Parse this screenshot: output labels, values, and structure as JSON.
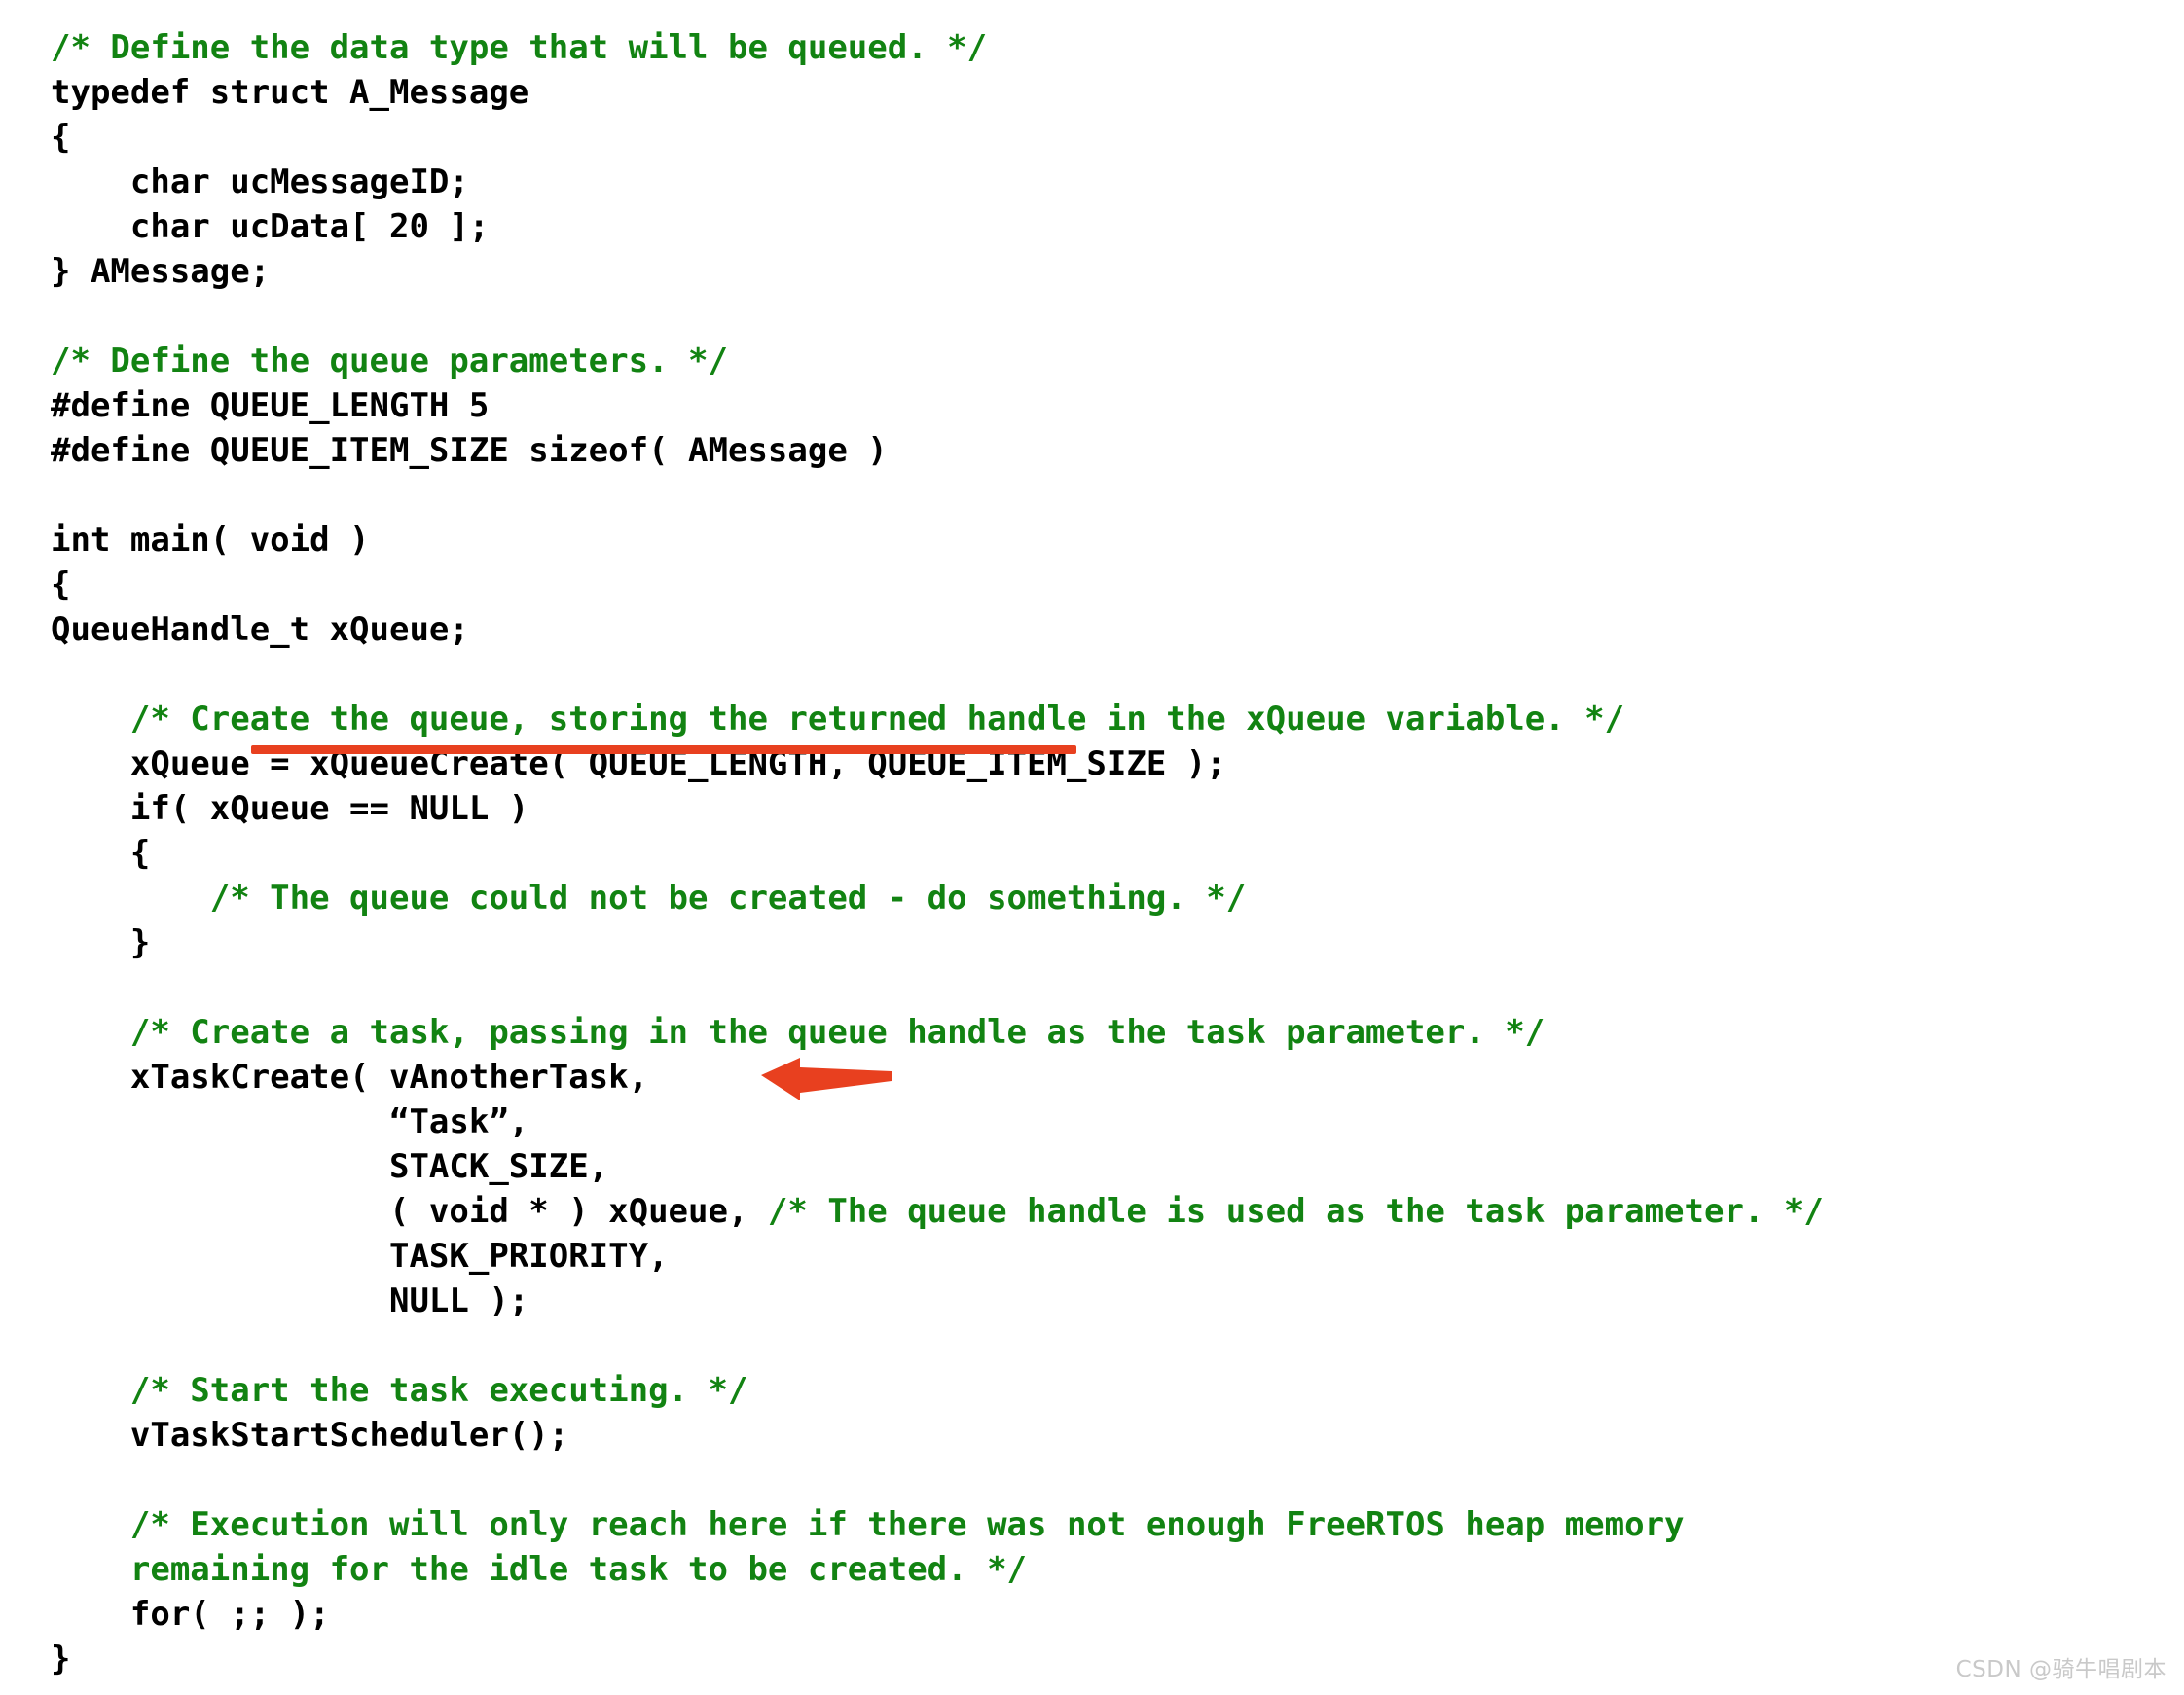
{
  "document": {
    "kind": "code-snippet-screenshot",
    "language": "C",
    "background_color": "#ffffff",
    "code_color": "#000000",
    "comment_color": "#128312",
    "annotation_color": "#e8401f",
    "lines": [
      {
        "indent": 0,
        "segments": [
          {
            "type": "comment",
            "text": "/* Define the data type that will be queued. */"
          }
        ]
      },
      {
        "indent": 0,
        "segments": [
          {
            "type": "code",
            "text": "typedef struct A_Message"
          }
        ]
      },
      {
        "indent": 0,
        "segments": [
          {
            "type": "code",
            "text": "{"
          }
        ]
      },
      {
        "indent": 0,
        "segments": [
          {
            "type": "code",
            "text": "    char ucMessageID;"
          }
        ]
      },
      {
        "indent": 0,
        "segments": [
          {
            "type": "code",
            "text": "    char ucData[ 20 ];"
          }
        ]
      },
      {
        "indent": 0,
        "segments": [
          {
            "type": "code",
            "text": "} AMessage;"
          }
        ]
      },
      {
        "indent": 0,
        "segments": [
          {
            "type": "code",
            "text": ""
          }
        ]
      },
      {
        "indent": 0,
        "segments": [
          {
            "type": "comment",
            "text": "/* Define the queue parameters. */"
          }
        ]
      },
      {
        "indent": 0,
        "segments": [
          {
            "type": "code",
            "text": "#define QUEUE_LENGTH 5"
          }
        ]
      },
      {
        "indent": 0,
        "segments": [
          {
            "type": "code",
            "text": "#define QUEUE_ITEM_SIZE sizeof( AMessage )"
          }
        ]
      },
      {
        "indent": 0,
        "segments": [
          {
            "type": "code",
            "text": ""
          }
        ]
      },
      {
        "indent": 0,
        "segments": [
          {
            "type": "code",
            "text": "int main( void )"
          }
        ]
      },
      {
        "indent": 0,
        "segments": [
          {
            "type": "code",
            "text": "{"
          }
        ]
      },
      {
        "indent": 0,
        "segments": [
          {
            "type": "code",
            "text": "QueueHandle_t xQueue;"
          }
        ]
      },
      {
        "indent": 0,
        "segments": [
          {
            "type": "code",
            "text": ""
          }
        ]
      },
      {
        "indent": 0,
        "segments": [
          {
            "type": "comment",
            "text": "    /* Create the queue, storing the returned handle in the xQueue variable. */"
          }
        ]
      },
      {
        "indent": 0,
        "segments": [
          {
            "type": "code",
            "text": "    xQueue = xQueueCreate( QUEUE_LENGTH, QUEUE_ITEM_SIZE );"
          }
        ]
      },
      {
        "indent": 0,
        "segments": [
          {
            "type": "code",
            "text": "    if( xQueue == NULL )"
          }
        ]
      },
      {
        "indent": 0,
        "segments": [
          {
            "type": "code",
            "text": "    {"
          }
        ]
      },
      {
        "indent": 0,
        "segments": [
          {
            "type": "comment",
            "text": "        /* The queue could not be created - do something. */"
          }
        ]
      },
      {
        "indent": 0,
        "segments": [
          {
            "type": "code",
            "text": "    }"
          }
        ]
      },
      {
        "indent": 0,
        "segments": [
          {
            "type": "code",
            "text": ""
          }
        ]
      },
      {
        "indent": 0,
        "segments": [
          {
            "type": "comment",
            "text": "    /* Create a task, passing in the queue handle as the task parameter. */"
          }
        ]
      },
      {
        "indent": 0,
        "segments": [
          {
            "type": "code",
            "text": "    xTaskCreate( vAnotherTask,"
          }
        ]
      },
      {
        "indent": 0,
        "segments": [
          {
            "type": "code",
            "text": "                 “Task”,"
          }
        ]
      },
      {
        "indent": 0,
        "segments": [
          {
            "type": "code",
            "text": "                 STACK_SIZE,"
          }
        ]
      },
      {
        "indent": 0,
        "segments": [
          {
            "type": "code",
            "text": "                 ( void * ) xQueue, "
          },
          {
            "type": "comment",
            "text": "/* The queue handle is used as the task parameter. */"
          }
        ]
      },
      {
        "indent": 0,
        "segments": [
          {
            "type": "code",
            "text": "                 TASK_PRIORITY,"
          }
        ]
      },
      {
        "indent": 0,
        "segments": [
          {
            "type": "code",
            "text": "                 NULL );"
          }
        ]
      },
      {
        "indent": 0,
        "segments": [
          {
            "type": "code",
            "text": ""
          }
        ]
      },
      {
        "indent": 0,
        "segments": [
          {
            "type": "comment",
            "text": "    /* Start the task executing. */"
          }
        ]
      },
      {
        "indent": 0,
        "segments": [
          {
            "type": "code",
            "text": "    vTaskStartScheduler();"
          }
        ]
      },
      {
        "indent": 0,
        "segments": [
          {
            "type": "code",
            "text": ""
          }
        ]
      },
      {
        "indent": 0,
        "segments": [
          {
            "type": "comment",
            "text": "    /* Execution will only reach here if there was not enough FreeRTOS heap memory"
          }
        ]
      },
      {
        "indent": 0,
        "segments": [
          {
            "type": "comment",
            "text": "    remaining for the idle task to be created. */"
          }
        ]
      },
      {
        "indent": 0,
        "segments": [
          {
            "type": "code",
            "text": "    for( ;; );"
          }
        ]
      },
      {
        "indent": 0,
        "segments": [
          {
            "type": "code",
            "text": "}"
          }
        ]
      }
    ]
  },
  "annotations": {
    "underline": {
      "label": "red-underline-xqueuecreate-call",
      "target_text": "xQueueCreate( QUEUE_LENGTH, QUEUE_ITEM_SIZE );",
      "color": "#e8401f"
    },
    "arrow": {
      "label": "red-arrow-pointing-to-vanothertask",
      "direction": "left",
      "target_text": "vAnotherTask,",
      "color": "#e8401f"
    }
  },
  "watermark": {
    "text": "CSDN @骑牛唱剧本"
  }
}
